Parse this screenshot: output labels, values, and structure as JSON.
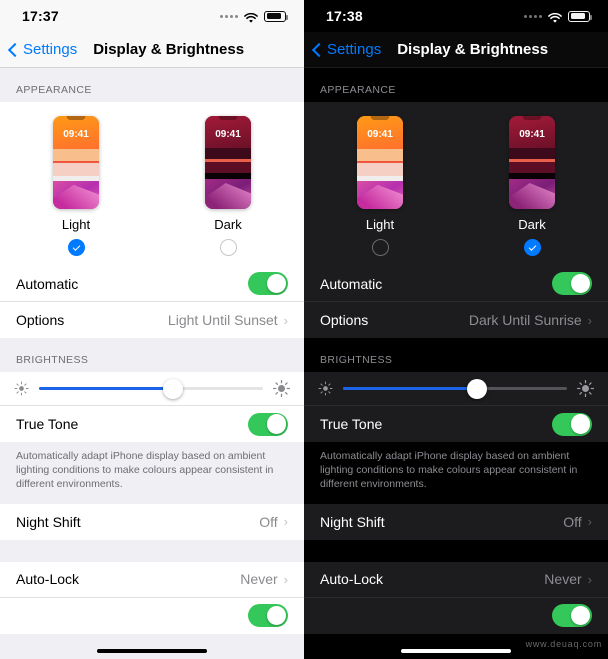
{
  "watermark": "www.deuaq.com",
  "panels": [
    {
      "theme": "light",
      "status": {
        "time": "17:37",
        "signal_icon": "signal-dots-icon",
        "wifi_icon": "wifi-icon",
        "battery_icon": "battery-icon"
      },
      "nav": {
        "back_label": "Settings",
        "title": "Display & Brightness"
      },
      "appearance": {
        "header": "APPEARANCE",
        "modes": [
          {
            "name": "Light",
            "clock": "09:41",
            "selected": true
          },
          {
            "name": "Dark",
            "clock": "09:41",
            "selected": false
          }
        ],
        "automatic": {
          "label": "Automatic",
          "on": true
        },
        "options": {
          "label": "Options",
          "value": "Light Until Sunset",
          "chevron": "›"
        }
      },
      "brightness": {
        "header": "BRIGHTNESS",
        "slider": {
          "value_percent": 60,
          "low_icon": "brightness-low-icon",
          "high_icon": "brightness-high-icon"
        },
        "true_tone": {
          "label": "True Tone",
          "on": true
        },
        "footnote": "Automatically adapt iPhone display based on ambient lighting conditions to make colours appear consistent in different environments."
      },
      "night_shift": {
        "label": "Night Shift",
        "value": "Off",
        "chevron": "›"
      },
      "auto_lock": {
        "label": "Auto-Lock",
        "value": "Never",
        "chevron": "›"
      },
      "partial_row": {
        "toggle_on": true
      }
    },
    {
      "theme": "dark",
      "status": {
        "time": "17:38",
        "signal_icon": "signal-dots-icon",
        "wifi_icon": "wifi-icon",
        "battery_icon": "battery-icon"
      },
      "nav": {
        "back_label": "Settings",
        "title": "Display & Brightness"
      },
      "appearance": {
        "header": "APPEARANCE",
        "modes": [
          {
            "name": "Light",
            "clock": "09:41",
            "selected": false
          },
          {
            "name": "Dark",
            "clock": "09:41",
            "selected": true
          }
        ],
        "automatic": {
          "label": "Automatic",
          "on": true
        },
        "options": {
          "label": "Options",
          "value": "Dark Until Sunrise",
          "chevron": "›"
        }
      },
      "brightness": {
        "header": "BRIGHTNESS",
        "slider": {
          "value_percent": 60,
          "low_icon": "brightness-low-icon",
          "high_icon": "brightness-high-icon"
        },
        "true_tone": {
          "label": "True Tone",
          "on": true
        },
        "footnote": "Automatically adapt iPhone display based on ambient lighting conditions to make colours appear consistent in different environments."
      },
      "night_shift": {
        "label": "Night Shift",
        "value": "Off",
        "chevron": "›"
      },
      "auto_lock": {
        "label": "Auto-Lock",
        "value": "Never",
        "chevron": "›"
      },
      "partial_row": {
        "toggle_on": true
      }
    }
  ],
  "colors": {
    "accent_blue": "#007AFF",
    "toggle_green": "#34C759",
    "slider_blue": "#1B64E8"
  }
}
